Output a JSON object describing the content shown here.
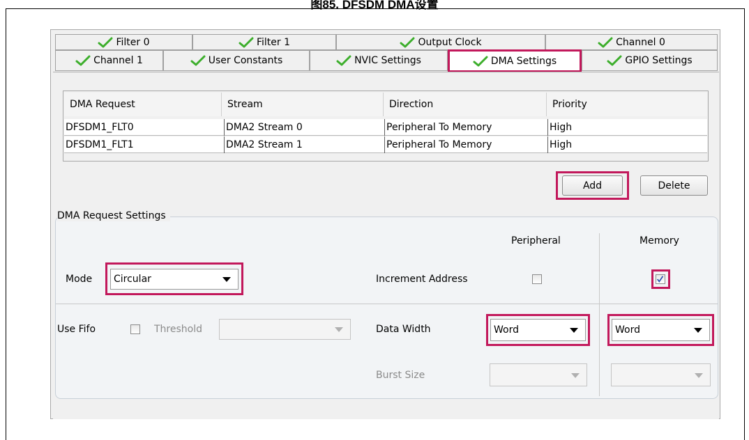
{
  "figure_title": "图85. DFSDM DMA设置",
  "tabs_row1": [
    {
      "label": "Filter 0"
    },
    {
      "label": "Filter 1"
    },
    {
      "label": "Output Clock"
    },
    {
      "label": "Channel 0"
    }
  ],
  "tabs_row2": [
    {
      "label": "Channel 1"
    },
    {
      "label": "User Constants"
    },
    {
      "label": "NVIC Settings"
    },
    {
      "label": "DMA Settings"
    },
    {
      "label": "GPIO Settings"
    }
  ],
  "table": {
    "headers": [
      "DMA Request",
      "Stream",
      "Direction",
      "Priority"
    ],
    "rows": [
      [
        "DFSDM1_FLT0",
        "DMA2 Stream 0",
        "Peripheral To Memory",
        "High"
      ],
      [
        "DFSDM1_FLT1",
        "DMA2 Stream 1",
        "Peripheral To Memory",
        "High"
      ]
    ]
  },
  "buttons": {
    "add": "Add",
    "delete": "Delete"
  },
  "settings": {
    "group_title": "DMA Request Settings",
    "col_peripheral": "Peripheral",
    "col_memory": "Memory",
    "mode_label": "Mode",
    "mode_value": "Circular",
    "increment_label": "Increment Address",
    "use_fifo_label": "Use Fifo",
    "threshold_label": "Threshold",
    "threshold_value": "",
    "data_width_label": "Data Width",
    "peripheral_width": "Word",
    "memory_width": "Word",
    "burst_label": "Burst Size",
    "peripheral_burst": "",
    "memory_burst": "",
    "peripheral_increment_checked": false,
    "memory_increment_checked": true,
    "use_fifo_checked": false
  },
  "colors": {
    "highlight": "#c2185b",
    "check_green": "#3cae2b"
  }
}
